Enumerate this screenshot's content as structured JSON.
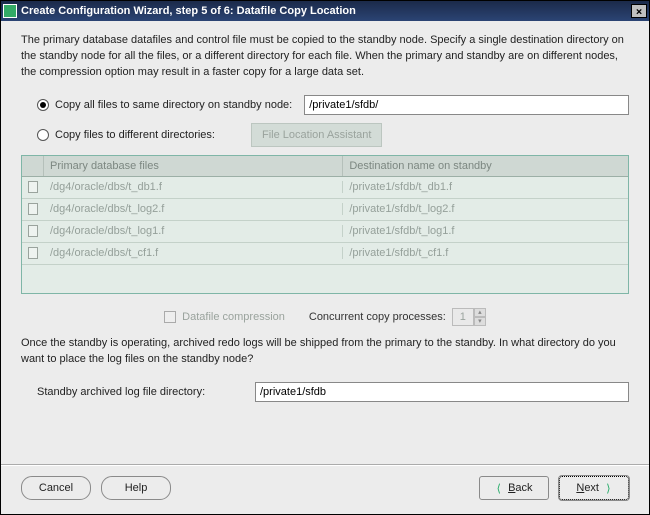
{
  "window": {
    "title": "Create Configuration Wizard, step 5 of 6: Datafile Copy Location"
  },
  "intro": "The primary database datafiles and control file must be copied to the standby node. Specify a single destination directory on the standby node for all the files, or a different directory for each file. When the primary and standby are on different nodes, the compression option may result in a faster copy for a large data set.",
  "options": {
    "same_dir_label": "Copy all files to same directory on standby node:",
    "same_dir_value": "/private1/sfdb/",
    "diff_dir_label": "Copy files to different directories:",
    "fla_button": "File Location Assistant"
  },
  "table": {
    "col1": "Primary database files",
    "col2": "Destination name on standby",
    "rows": [
      {
        "src": "/dg4/oracle/dbs/t_db1.f",
        "dst": "/private1/sfdb/t_db1.f"
      },
      {
        "src": "/dg4/oracle/dbs/t_log2.f",
        "dst": "/private1/sfdb/t_log2.f"
      },
      {
        "src": "/dg4/oracle/dbs/t_log1.f",
        "dst": "/private1/sfdb/t_log1.f"
      },
      {
        "src": "/dg4/oracle/dbs/t_cf1.f",
        "dst": "/private1/sfdb/t_cf1.f"
      }
    ]
  },
  "mid": {
    "compress_label": "Datafile compression",
    "processes_label": "Concurrent copy processes:",
    "processes_value": "1"
  },
  "para2": "Once the standby is operating, archived redo logs will be shipped from the primary to the standby. In what directory do you want to place the log files on the standby node?",
  "standby": {
    "label": "Standby archived log file directory:",
    "value": "/private1/sfdb"
  },
  "buttons": {
    "cancel": "Cancel",
    "help": "Help",
    "back": "Back",
    "next": "Next"
  }
}
